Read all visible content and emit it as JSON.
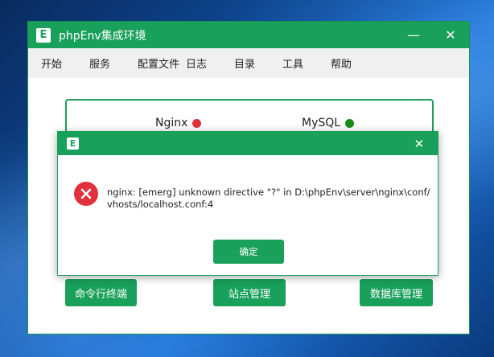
{
  "app": {
    "title": "phpEnv集成环境",
    "logo_letter": "E",
    "minimize": "—",
    "close": "✕"
  },
  "menu": [
    "开始",
    "服务",
    "配置文件",
    "日志",
    "目录",
    "工具",
    "帮助"
  ],
  "services": [
    {
      "name": "Nginx",
      "status": "stopped",
      "color": "#e0313c"
    },
    {
      "name": "MySQL",
      "status": "running",
      "color": "#1a8a1a"
    }
  ],
  "buttons": {
    "terminal": "命令行终端",
    "sites": "站点管理",
    "database": "数据库管理"
  },
  "dialog": {
    "logo_letter": "E",
    "close": "✕",
    "message_line1": "nginx: [emerg] unknown directive \"?\" in D:\\phpEnv\\server\\nginx\\conf/",
    "message_line2": "vhosts/localhost.conf:4",
    "ok_label": "确定"
  },
  "colors": {
    "accent": "#19a05a",
    "error": "#e0313c"
  }
}
